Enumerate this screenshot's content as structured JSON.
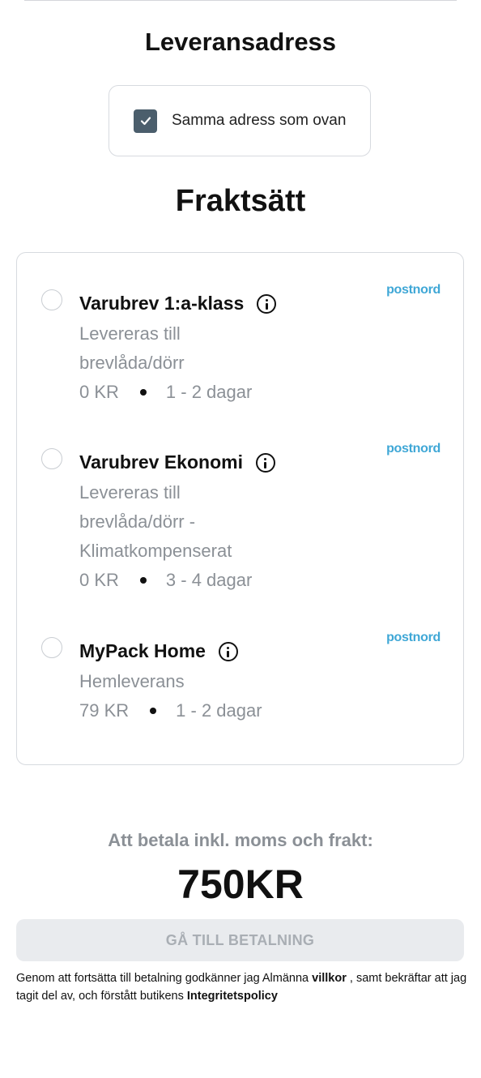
{
  "delivery_address": {
    "title": "Leveransadress",
    "same_as_above": {
      "label": "Samma adress som ovan",
      "checked": true
    }
  },
  "shipping": {
    "title": "Fraktsätt",
    "options": [
      {
        "name": "Varubrev 1:a-klass",
        "carrier": "postnord",
        "desc_lines": [
          "Levereras till",
          "brevlåda/dörr"
        ],
        "price": "0 KR",
        "delivery_time": "1 - 2 dagar",
        "selected": false
      },
      {
        "name": "Varubrev Ekonomi",
        "carrier": "postnord",
        "desc_lines": [
          "Levereras till",
          "brevlåda/dörr -",
          "Klimatkompenserat"
        ],
        "price": "0 KR",
        "delivery_time": "3 - 4 dagar",
        "selected": false
      },
      {
        "name": "MyPack Home",
        "carrier": "postnord",
        "desc_lines": [
          "Hemleverans"
        ],
        "price": "79 KR",
        "delivery_time": "1 - 2 dagar",
        "selected": false
      }
    ]
  },
  "summary": {
    "total_label": "Att betala inkl. moms och frakt:",
    "total_amount": "750KR",
    "pay_button": "GÅ TILL BETALNING"
  },
  "terms": {
    "part1": "Genom att fortsätta till betalning godkänner jag Almänna ",
    "link1": "villkor",
    "part2": " , samt bekräftar att jag tagit del av, och förstått butikens ",
    "link2": "Integritetspolicy"
  },
  "icons": {
    "checkbox": "check-icon",
    "info": "info-icon",
    "brand_color": "#3fa7d6",
    "checkbox_color": "#4b5e6c"
  }
}
